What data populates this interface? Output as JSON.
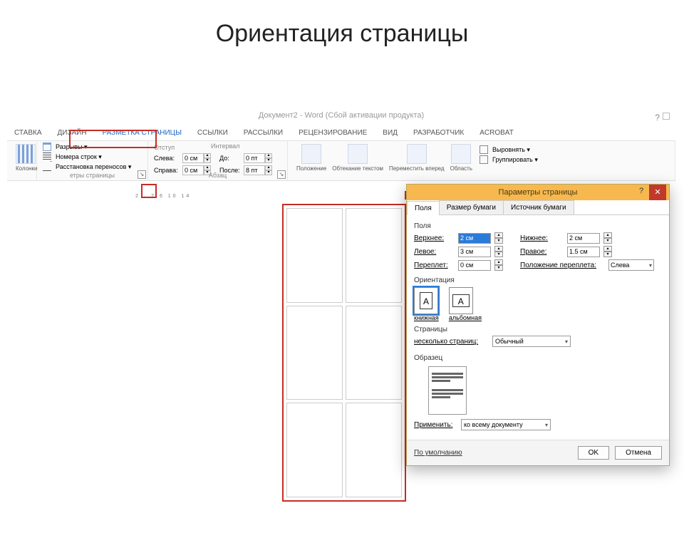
{
  "slide": {
    "title": "Ориентация страницы"
  },
  "titlebar": {
    "text": "Документ2 - Word (Сбой активации продукта)"
  },
  "tabs": [
    "СТАВКА",
    "ДИЗАЙН",
    "РАЗМЕТКА СТРАНИЦЫ",
    "ССЫЛКИ",
    "РАССЫЛКИ",
    "РЕЦЕНЗИРОВАНИЕ",
    "ВИД",
    "РАЗРАБОТЧИК",
    "ACROBAT"
  ],
  "ribbon": {
    "columns_label": "Колонки",
    "breaks": "Разрывы ▾",
    "line_numbers": "Номера строк ▾",
    "hyphenation": "Расстановка переносов ▾",
    "page_setup_group": "етры страницы",
    "indent_group": "Отступ",
    "left_label": "Слева:",
    "right_label": "Справа:",
    "left_val": "0 см",
    "right_val": "0 см",
    "spacing_group": "Интервал",
    "before_label": "До:",
    "after_label": "После:",
    "before_val": "0 пт",
    "after_val": "8 пт",
    "paragraph_group": "Абзац",
    "position": "Положение",
    "wrap": "Обтекание текстом",
    "forward": "Переместить вперед",
    "area": "Область",
    "align": "Выровнять ▾",
    "group_obj": "Группировать ▾"
  },
  "ruler": "2 · 2   6  10  14",
  "dialog": {
    "title": "Параметры страницы",
    "tabs": [
      "Поля",
      "Размер бумаги",
      "Источник бумаги"
    ],
    "sect_margins": "Поля",
    "top_l": "Верхнее:",
    "top_v": "2 см",
    "bottom_l": "Нижнее:",
    "bottom_v": "2 см",
    "left_l": "Левое:",
    "left_v": "3 см",
    "right_l": "Правое:",
    "right_v": "1.5 см",
    "gutter_l": "Переплет:",
    "gutter_v": "0 см",
    "gutter_pos_l": "Положение переплета:",
    "gutter_pos_v": "Слева",
    "sect_orient": "Ориентация",
    "orient_portrait": "книжная",
    "orient_landscape": "альбомная",
    "sect_pages": "Страницы",
    "multi_l": "несколько страниц:",
    "multi_v": "Обычный",
    "sect_preview": "Образец",
    "apply_l": "Применить:",
    "apply_v": "ко всему документу",
    "default_btn": "По умолчанию",
    "ok": "OK",
    "cancel": "Отмена"
  }
}
